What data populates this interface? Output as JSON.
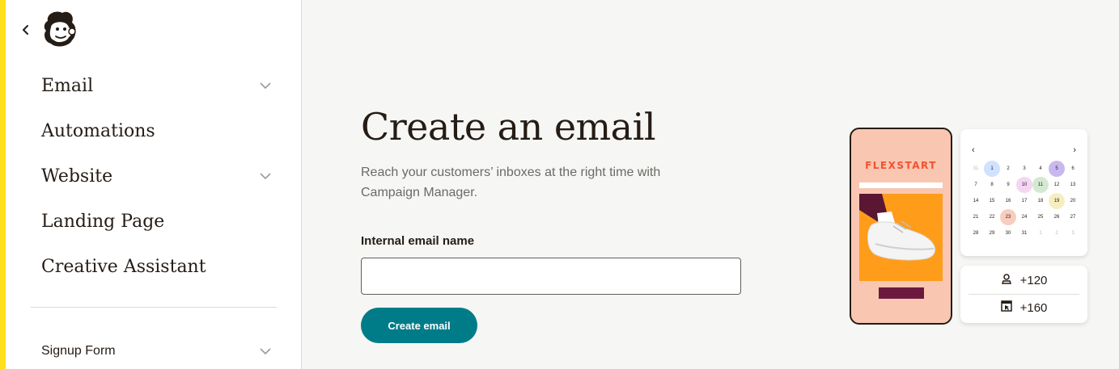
{
  "sidebar": {
    "items": [
      {
        "label": "Email",
        "expandable": true
      },
      {
        "label": "Automations",
        "expandable": false
      },
      {
        "label": "Website",
        "expandable": true
      },
      {
        "label": "Landing Page",
        "expandable": false
      },
      {
        "label": "Creative Assistant",
        "expandable": false
      }
    ],
    "sub_items": [
      {
        "label": "Signup Form",
        "expandable": true
      }
    ],
    "icons": {
      "back": "chevron-left-icon",
      "logo": "mailchimp-freddie-logo",
      "expand": "chevron-down-icon"
    }
  },
  "main": {
    "title": "Create an email",
    "subtitle": "Reach your customers’ inboxes at the right time with Campaign Manager.",
    "field_label": "Internal email name",
    "field_value": "",
    "field_placeholder": "",
    "submit_label": "Create email"
  },
  "illustration": {
    "brand": "FLEXSTART",
    "calendar": {
      "prev": "‹",
      "next": "›",
      "days": [
        {
          "d": "31",
          "muted": true
        },
        {
          "d": "1",
          "hl": "#cfe2ff"
        },
        {
          "d": "2"
        },
        {
          "d": "3"
        },
        {
          "d": "4"
        },
        {
          "d": "5",
          "hl": "#c9b8ef"
        },
        {
          "d": "6"
        },
        {
          "d": "7"
        },
        {
          "d": "8"
        },
        {
          "d": "9"
        },
        {
          "d": "10",
          "hl": "#f6d5f3"
        },
        {
          "d": "11",
          "hl": "#d4ead0"
        },
        {
          "d": "12"
        },
        {
          "d": "13"
        },
        {
          "d": "14"
        },
        {
          "d": "15"
        },
        {
          "d": "16"
        },
        {
          "d": "17"
        },
        {
          "d": "18"
        },
        {
          "d": "19",
          "hl": "#f7edc2"
        },
        {
          "d": "20"
        },
        {
          "d": "21"
        },
        {
          "d": "22"
        },
        {
          "d": "23",
          "hl": "#f8cdbf"
        },
        {
          "d": "24"
        },
        {
          "d": "25"
        },
        {
          "d": "26"
        },
        {
          "d": "27"
        },
        {
          "d": "28"
        },
        {
          "d": "29"
        },
        {
          "d": "30"
        },
        {
          "d": "31"
        },
        {
          "d": "1",
          "muted": true
        },
        {
          "d": "2",
          "muted": true
        },
        {
          "d": "3",
          "muted": true
        }
      ]
    },
    "stats": [
      {
        "icon": "person-icon",
        "value": "+120"
      },
      {
        "icon": "click-cursor-icon",
        "value": "+160"
      }
    ]
  },
  "colors": {
    "accent_yellow": "#ffe01b",
    "primary_teal": "#007c89",
    "brand_orange": "#f2522e",
    "peach": "#f9c6b2"
  }
}
